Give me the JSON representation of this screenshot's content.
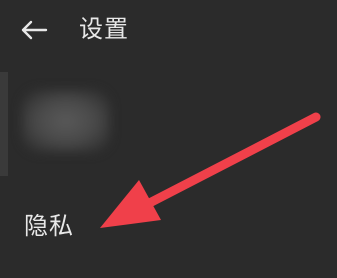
{
  "header": {
    "back_icon": "arrow-left-icon",
    "title": "设置"
  },
  "profile": {
    "content_state": "blurred"
  },
  "settings": {
    "privacy_label": "隐私"
  },
  "annotation": {
    "arrow_color": "#f0404a",
    "target": "privacy"
  },
  "colors": {
    "background": "#2b2b2b",
    "text": "#e8e8e8"
  }
}
